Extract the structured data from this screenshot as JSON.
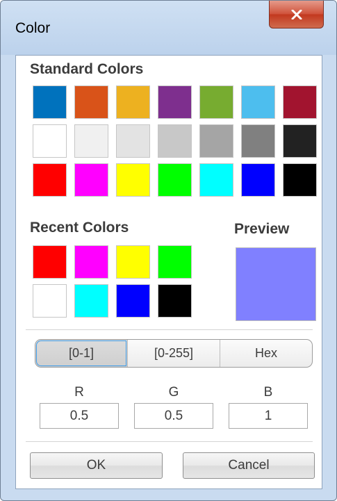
{
  "window": {
    "title": "Color"
  },
  "standard_colors": {
    "label": "Standard Colors",
    "rows": [
      [
        "#0072bd",
        "#d95319",
        "#edb120",
        "#7e2f8e",
        "#77ac30",
        "#4dbeee",
        "#a2142f"
      ],
      [
        "#ffffff",
        "#f0f0f0",
        "#e3e3e3",
        "#c8c8c8",
        "#a5a5a5",
        "#808080",
        "#222222"
      ],
      [
        "#ff0000",
        "#ff00ff",
        "#ffff00",
        "#00ff00",
        "#00ffff",
        "#0000ff",
        "#000000"
      ]
    ]
  },
  "recent_colors": {
    "label": "Recent Colors",
    "rows": [
      [
        "#ff0000",
        "#ff00ff",
        "#ffff00",
        "#00ff00"
      ],
      [
        "#ffffff",
        "#00ffff",
        "#0000ff",
        "#000000"
      ]
    ]
  },
  "preview": {
    "label": "Preview",
    "color": "#8080ff"
  },
  "format_tabs": [
    {
      "label": "[0-1]",
      "active": true
    },
    {
      "label": "[0-255]",
      "active": false
    },
    {
      "label": "Hex",
      "active": false
    }
  ],
  "channels": [
    {
      "label": "R",
      "value": "0.5"
    },
    {
      "label": "G",
      "value": "0.5"
    },
    {
      "label": "B",
      "value": "1"
    }
  ],
  "buttons": {
    "ok": "OK",
    "cancel": "Cancel"
  },
  "icons": {
    "close": "close-icon"
  },
  "colors": {
    "close_button": "#c3391f",
    "active_tab_outline": "#3e9ce8",
    "section_label": "#3c3c3c"
  }
}
